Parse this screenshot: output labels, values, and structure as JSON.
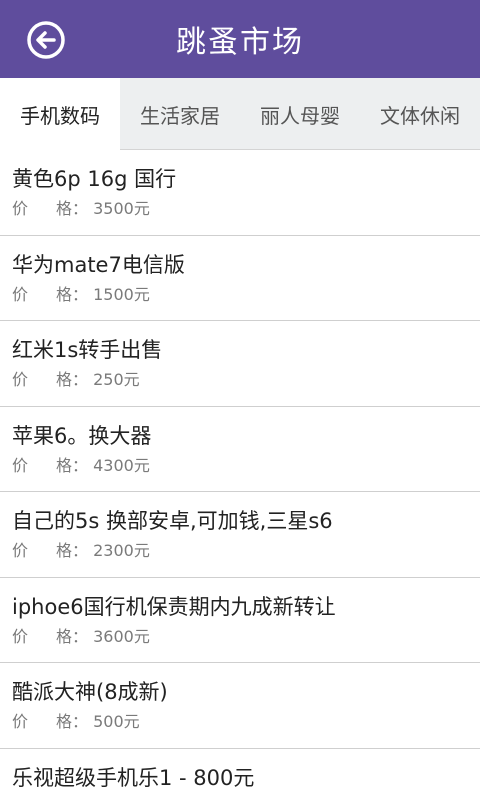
{
  "header": {
    "title": "跳蚤市场",
    "back_icon": "back-arrow-icon"
  },
  "tabs": [
    {
      "label": "手机数码",
      "active": true
    },
    {
      "label": "生活家居",
      "active": false
    },
    {
      "label": "丽人母婴",
      "active": false
    },
    {
      "label": "文体休闲",
      "active": false
    }
  ],
  "price_label_a": "价",
  "price_label_b": "格：",
  "items": [
    {
      "title": "黄色6p 16g 国行",
      "price": "3500元"
    },
    {
      "title": "华为mate7电信版",
      "price": "1500元"
    },
    {
      "title": "红米1s转手出售",
      "price": "250元"
    },
    {
      "title": "苹果6。换大器",
      "price": "4300元"
    },
    {
      "title": "自己的5s 换部安卓,可加钱,三星s6",
      "price": "2300元"
    },
    {
      "title": "iphoe6国行机保责期内九成新转让",
      "price": "3600元"
    },
    {
      "title": "酷派大神(8成新)",
      "price": "500元"
    },
    {
      "title": "乐视超级手机乐1 - 800元",
      "price": ""
    }
  ],
  "colors": {
    "header_bg": "#5f4d9d",
    "tab_bg": "#edeff0"
  }
}
